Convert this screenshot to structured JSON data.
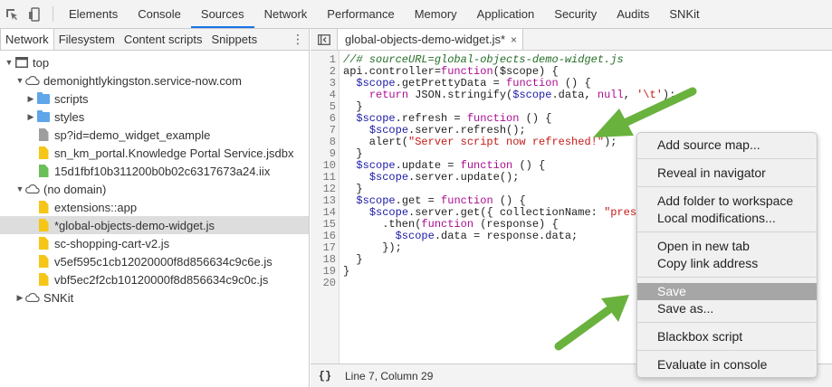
{
  "toolbar": {
    "tabs": [
      "Elements",
      "Console",
      "Sources",
      "Network",
      "Performance",
      "Memory",
      "Application",
      "Security",
      "Audits",
      "SNKit"
    ],
    "active_tab": "Sources"
  },
  "navigator": {
    "tabs": [
      "Network",
      "Filesystem",
      "Content scripts",
      "Snippets"
    ],
    "more": "⋮",
    "tree": {
      "top": "top",
      "domain": "demonightlykingston.service-now.com",
      "scripts": "scripts",
      "styles": "styles",
      "sp": "sp?id=demo_widget_example",
      "jsdbx": "sn_km_portal.Knowledge Portal Service.jsdbx",
      "iix": "15d1fbf10b311200b0b02c6317673a24.iix",
      "nodomain": "(no domain)",
      "ext": "extensions::app",
      "widget": "*global-objects-demo-widget.js",
      "cart": "sc-shopping-cart-v2.js",
      "v5": "v5ef595c1cb12020000f8d856634c9c6e.js",
      "vbf": "vbf5ec2f2cb10120000f8d856634c9c0c.js",
      "snkit": "SNKit"
    }
  },
  "editor": {
    "tab_label": "global-objects-demo-widget.js*",
    "close": "×",
    "line_numbers": [
      "1",
      "2",
      "3",
      "4",
      "5",
      "6",
      "7",
      "8",
      "9",
      "10",
      "11",
      "12",
      "13",
      "14",
      "15",
      "16",
      "17",
      "18",
      "19",
      "20"
    ],
    "status_braces": "{}",
    "status_position": "Line 7, Column 29"
  },
  "context_menu": {
    "add_source_map": "Add source map...",
    "reveal": "Reveal in navigator",
    "add_folder": "Add folder to workspace",
    "local_mods": "Local modifications...",
    "open_tab": "Open in new tab",
    "copy_link": "Copy link address",
    "save": "Save",
    "save_as": "Save as...",
    "blackbox": "Blackbox script",
    "evaluate": "Evaluate in console"
  },
  "colors": {
    "arrow": "#6ab23e",
    "accent": "#1a73e8",
    "menu_highlight": "#a6a6a6"
  }
}
